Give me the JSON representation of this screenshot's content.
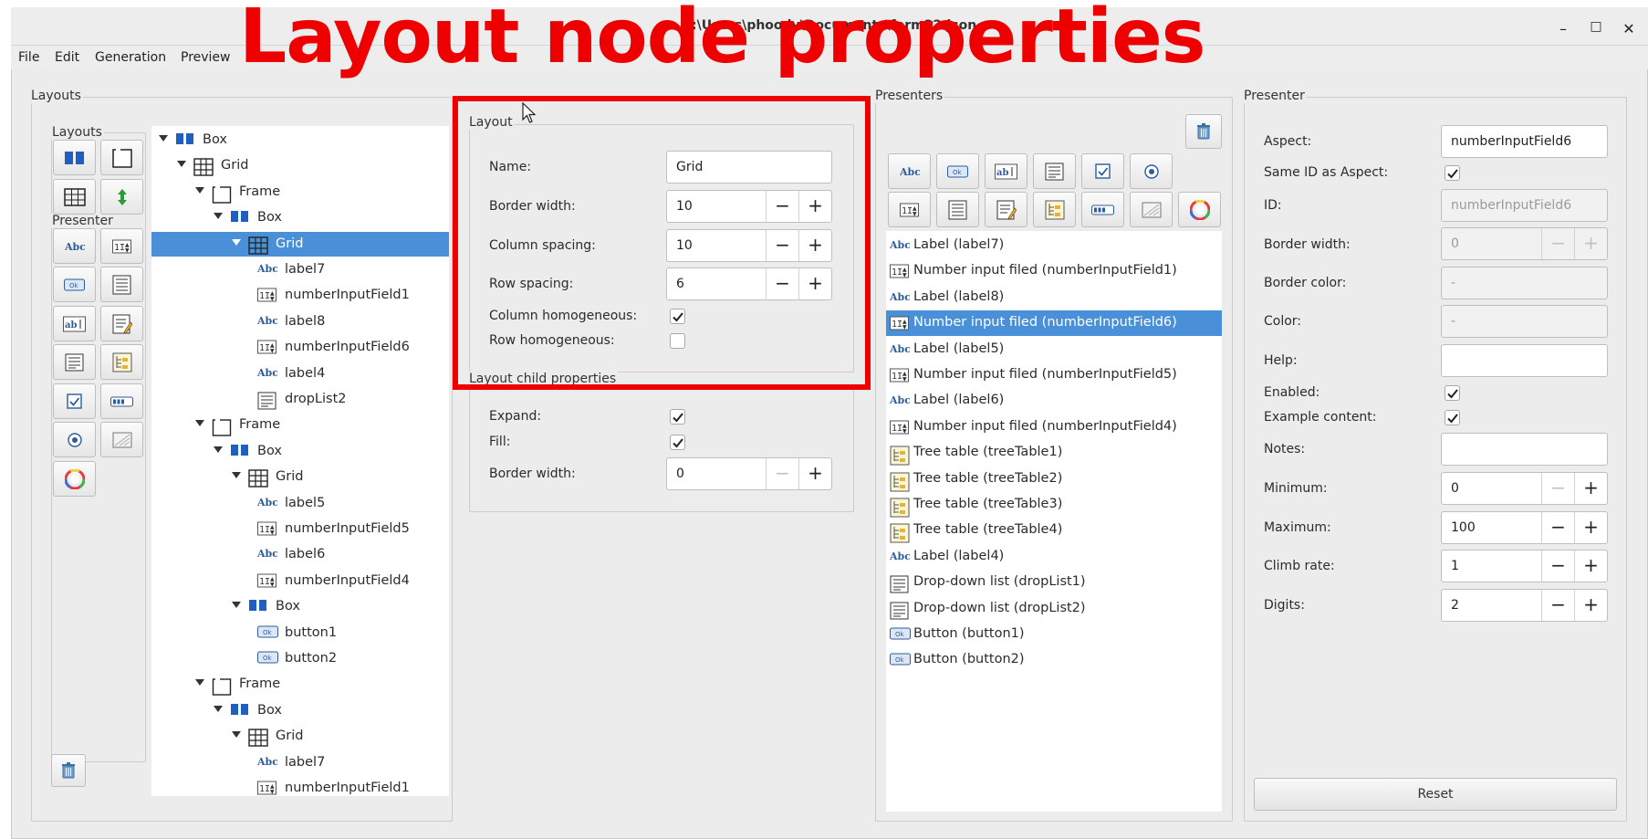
{
  "window": {
    "title": "C:\\Users\\phoody\\Documents\\form22.json",
    "minimize": "–",
    "maximize": "□",
    "close": "✕"
  },
  "overlay_caption": "Layout node properties",
  "menu": [
    "File",
    "Edit",
    "Generation",
    "Preview"
  ],
  "layouts_panel": {
    "title": "Layouts",
    "layouts_group": "Layouts",
    "presenter_group": "Presenter"
  },
  "tree": [
    {
      "label": "Box",
      "icon": "box",
      "level": 0,
      "expanded": true
    },
    {
      "label": "Grid",
      "icon": "grid",
      "level": 1,
      "expanded": true
    },
    {
      "label": "Frame",
      "icon": "frame",
      "level": 2,
      "expanded": true
    },
    {
      "label": "Box",
      "icon": "box",
      "level": 3,
      "expanded": true
    },
    {
      "label": "Grid",
      "icon": "grid",
      "level": 4,
      "expanded": true,
      "selected": true
    },
    {
      "label": "label7",
      "icon": "label",
      "level": 5
    },
    {
      "label": "numberInputField1",
      "icon": "number",
      "level": 5
    },
    {
      "label": "label8",
      "icon": "label",
      "level": 5
    },
    {
      "label": "numberInputField6",
      "icon": "number",
      "level": 5
    },
    {
      "label": "label4",
      "icon": "label",
      "level": 5
    },
    {
      "label": "dropList2",
      "icon": "droplist",
      "level": 5
    },
    {
      "label": "Frame",
      "icon": "frame",
      "level": 2,
      "expanded": true
    },
    {
      "label": "Box",
      "icon": "box",
      "level": 3,
      "expanded": true
    },
    {
      "label": "Grid",
      "icon": "grid",
      "level": 4,
      "expanded": true
    },
    {
      "label": "label5",
      "icon": "label",
      "level": 5
    },
    {
      "label": "numberInputField5",
      "icon": "number",
      "level": 5
    },
    {
      "label": "label6",
      "icon": "label",
      "level": 5
    },
    {
      "label": "numberInputField4",
      "icon": "number",
      "level": 5
    },
    {
      "label": "Box",
      "icon": "box",
      "level": 4,
      "expanded": true
    },
    {
      "label": "button1",
      "icon": "button",
      "level": 5
    },
    {
      "label": "button2",
      "icon": "button",
      "level": 5
    },
    {
      "label": "Frame",
      "icon": "frame",
      "level": 2,
      "expanded": true
    },
    {
      "label": "Box",
      "icon": "box",
      "level": 3,
      "expanded": true
    },
    {
      "label": "Grid",
      "icon": "grid",
      "level": 4,
      "expanded": true
    },
    {
      "label": "label7",
      "icon": "label",
      "level": 5
    },
    {
      "label": "numberInputField1",
      "icon": "number",
      "level": 5
    }
  ],
  "layout_group": {
    "title": "Layout",
    "name_label": "Name:",
    "name_value": "Grid",
    "border_width_label": "Border width:",
    "border_width_value": "10",
    "column_spacing_label": "Column spacing:",
    "column_spacing_value": "10",
    "row_spacing_label": "Row spacing:",
    "row_spacing_value": "6",
    "column_homogeneous_label": "Column homogeneous:",
    "column_homogeneous": true,
    "row_homogeneous_label": "Row homogeneous:",
    "row_homogeneous": false
  },
  "child_group": {
    "title": "Layout child properties",
    "expand_label": "Expand:",
    "expand": true,
    "fill_label": "Fill:",
    "fill": true,
    "border_width_label": "Border width:",
    "border_width_value": "0"
  },
  "spin": {
    "minus": "−",
    "plus": "+"
  },
  "presenters_panel": {
    "title": "Presenters",
    "items": [
      {
        "label": "Label (label7)",
        "icon": "label"
      },
      {
        "label": "Number input filed (numberInputField1)",
        "icon": "number"
      },
      {
        "label": "Label (label8)",
        "icon": "label"
      },
      {
        "label": "Number input filed (numberInputField6)",
        "icon": "number",
        "selected": true
      },
      {
        "label": "Label (label5)",
        "icon": "label"
      },
      {
        "label": "Number input filed (numberInputField5)",
        "icon": "number"
      },
      {
        "label": "Label (label6)",
        "icon": "label"
      },
      {
        "label": "Number input filed (numberInputField4)",
        "icon": "number"
      },
      {
        "label": "Tree table (treeTable1)",
        "icon": "treetable"
      },
      {
        "label": "Tree table (treeTable2)",
        "icon": "treetable"
      },
      {
        "label": "Tree table (treeTable3)",
        "icon": "treetable"
      },
      {
        "label": "Tree table (treeTable4)",
        "icon": "treetable"
      },
      {
        "label": "Label (label4)",
        "icon": "label"
      },
      {
        "label": "Drop-down list (dropList1)",
        "icon": "droplist"
      },
      {
        "label": "Drop-down list (dropList2)",
        "icon": "droplist"
      },
      {
        "label": "Button (button1)",
        "icon": "button"
      },
      {
        "label": "Button (button2)",
        "icon": "button"
      }
    ]
  },
  "presenter_props": {
    "title": "Presenter",
    "aspect_label": "Aspect:",
    "aspect_value": "numberInputField6",
    "same_id_label": "Same ID as Aspect:",
    "same_id": true,
    "id_label": "ID:",
    "id_value": "numberInputField6",
    "border_width_label": "Border width:",
    "border_width_value": "0",
    "border_color_label": "Border color:",
    "border_color_value": "-",
    "color_label": "Color:",
    "color_value": "-",
    "help_label": "Help:",
    "help_value": "",
    "enabled_label": "Enabled:",
    "enabled": true,
    "example_label": "Example content:",
    "example": true,
    "notes_label": "Notes:",
    "notes_value": "",
    "minimum_label": "Minimum:",
    "minimum_value": "0",
    "maximum_label": "Maximum:",
    "maximum_value": "100",
    "climb_label": "Climb rate:",
    "climb_value": "1",
    "digits_label": "Digits:",
    "digits_value": "2",
    "reset_label": "Reset"
  },
  "colors": {
    "accent": "#4a90d9",
    "caption": "#ee0000",
    "box_icon": "#1f5fbf"
  }
}
